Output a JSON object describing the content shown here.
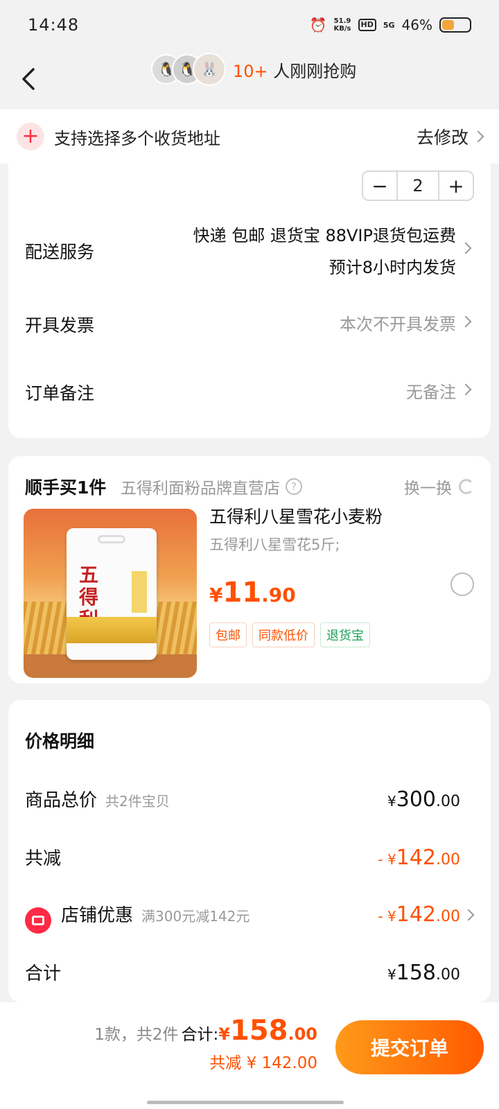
{
  "status": {
    "time": "14:48",
    "net_speed": "51.9",
    "net_unit": "KB/s",
    "hd": "HD",
    "signal": "5G",
    "battery": "46%",
    "battery_level": 0.46
  },
  "header": {
    "buyer_count": "10+",
    "buyer_text": " 人刚刚抢购"
  },
  "address_bar": {
    "text": "支持选择多个收货地址",
    "action": "去修改"
  },
  "quantity": {
    "minus": "−",
    "value": "2",
    "plus": "+"
  },
  "delivery": {
    "label": "配送服务",
    "line1": "快递 包邮 退货宝 88VIP退货包运费",
    "line2": "预计8小时内发货"
  },
  "invoice": {
    "label": "开具发票",
    "value": "本次不开具发票"
  },
  "remark": {
    "label": "订单备注",
    "value": "无备注"
  },
  "addon": {
    "title": "顺手买1件",
    "store": "五得利面粉品牌直营店",
    "swap": "换一换",
    "product_name": "五得利八星雪花小麦粉",
    "product_spec": "五得利八星雪花5斤;",
    "price_currency": "¥",
    "price_int": "11",
    "price_dec": ".90",
    "bag_brand": "五得利",
    "tags": [
      "包邮",
      "同款低价",
      "退货宝"
    ]
  },
  "price_detail": {
    "title": "价格明细",
    "goods_total_label": "商品总价",
    "goods_total_sub": "共2件宝贝",
    "goods_total": {
      "cur": "¥",
      "int": "300",
      "dec": ".00"
    },
    "discount_label": "共减",
    "discount": {
      "cur": "- ¥",
      "int": "142",
      "dec": ".00"
    },
    "shop_label": "店铺优惠",
    "shop_sub": "满300元减142元",
    "shop_discount": {
      "cur": "- ¥",
      "int": "142",
      "dec": ".00"
    },
    "sum_label": "合计",
    "sum": {
      "cur": "¥",
      "int": "158",
      "dec": ".00"
    }
  },
  "bottom": {
    "count": "1款，共2件",
    "total_label": "合计:",
    "price_cur": "¥",
    "price_int": "158",
    "price_dec": ".00",
    "saved": "共减 ¥ 142.00",
    "submit": "提交订单"
  },
  "colors": {
    "accent": "#ff5000",
    "green": "#19a05a",
    "red_icon": "#ff2a45"
  }
}
